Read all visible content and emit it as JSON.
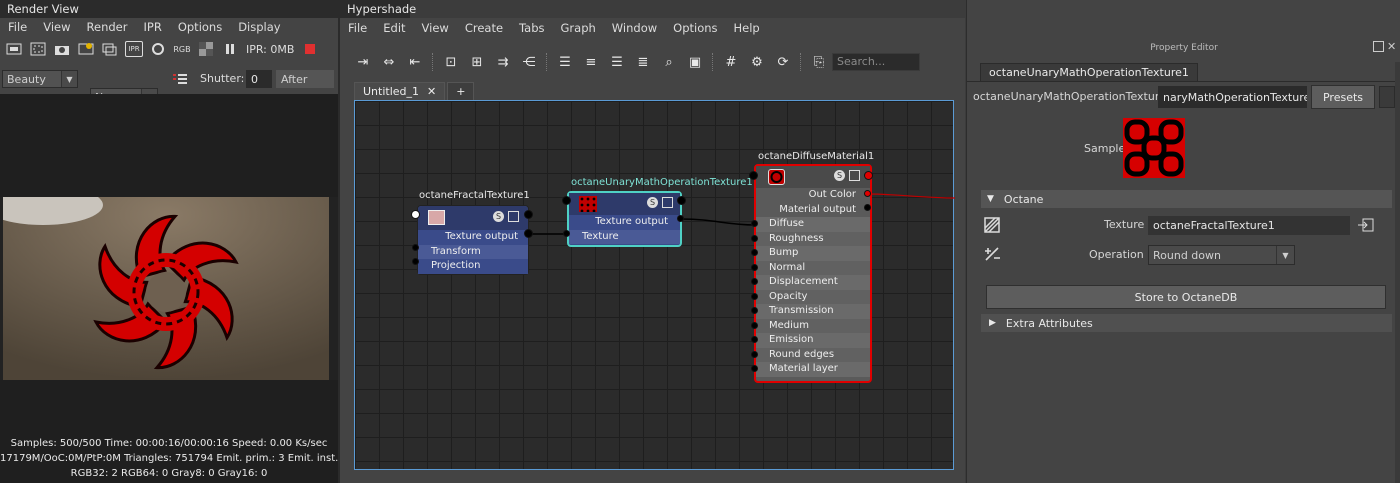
{
  "render_view": {
    "title": "Render View",
    "menu": [
      "File",
      "View",
      "Render",
      "IPR",
      "Options",
      "Display"
    ],
    "ipr_label": "IPR: 0MB",
    "rgb_label": "RGB",
    "ipr_icon_label": "IPR",
    "channel": "Beauty",
    "compare": "None",
    "shutter_label": "Shutter:",
    "shutter_value": "0",
    "after": "After",
    "stats": [
      "Samples: 500/500 Time: 00:00:16/00:00:16 Speed: 0.00 Ks/sec",
      "17179M/OoC:0M/PtP:0M Triangles: 751794 Emit. prim.: 3 Emit. inst.: 3 D",
      "RGB32: 2 RGB64: 0 Gray8: 0 Gray16: 0"
    ]
  },
  "hypershade": {
    "title": "Hypershade",
    "menu": [
      "File",
      "Edit",
      "View",
      "Create",
      "Tabs",
      "Graph",
      "Window",
      "Options",
      "Help"
    ],
    "search_placeholder": "Search...",
    "tab_label": "Untitled_1",
    "tab_close": "✕",
    "tab_add": "+",
    "nodes": {
      "fractal": {
        "title": "octaneFractalTexture1",
        "output": "Texture output",
        "inputs": [
          "Transform",
          "Projection"
        ]
      },
      "unary": {
        "title": "octaneUnaryMathOperationTexture1",
        "output": "Texture output",
        "inputs": [
          "Texture"
        ]
      },
      "diffuse": {
        "title": "octaneDiffuseMaterial1",
        "outputs": [
          "Out Color",
          "Material output"
        ],
        "inputs": [
          "Diffuse",
          "Roughness",
          "Bump",
          "Normal",
          "Displacement",
          "Opacity",
          "Transmission",
          "Medium",
          "Emission",
          "Round edges",
          "Material layer"
        ]
      }
    }
  },
  "property_editor": {
    "title": "Property Editor",
    "tab": "octaneUnaryMathOperationTexture1",
    "node_label": "octaneUnaryMathOperationTexture:",
    "node_value": "naryMathOperationTexture1",
    "presets": "Presets",
    "sample_label": "Sample",
    "section_octane": "Octane",
    "texture_label": "Texture",
    "texture_value": "octaneFractalTexture1",
    "operation_label": "Operation",
    "operation_value": "Round down",
    "store_button": "Store to OctaneDB",
    "section_extra": "Extra Attributes"
  },
  "colors": {
    "accent_blue": "#5b9bd5",
    "node_selected": "#e00000",
    "node_teal": "#4fd1c5",
    "texture_node": "#2e3a6a"
  }
}
